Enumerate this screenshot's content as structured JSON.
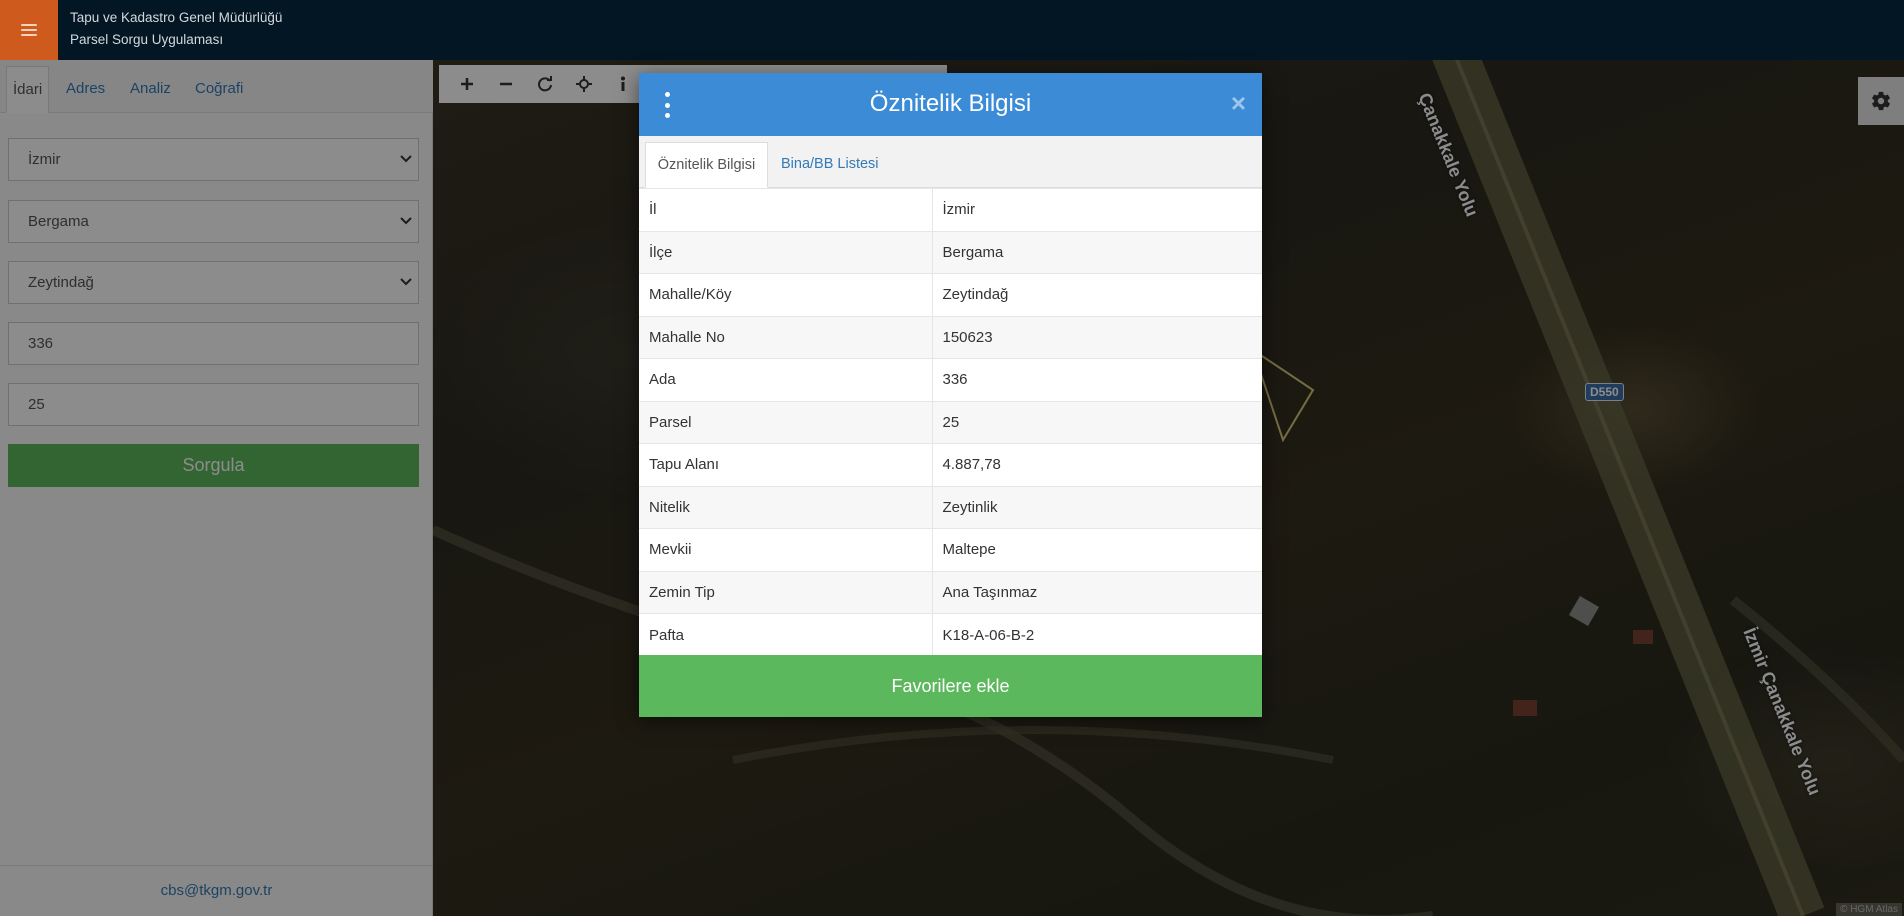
{
  "header": {
    "title_line1": "Tapu ve Kadastro Genel Müdürlüğü",
    "title_line2": "Parsel Sorgu Uygulaması"
  },
  "sidebar": {
    "tabs": [
      {
        "label": "İdari",
        "active": true
      },
      {
        "label": "Adres",
        "active": false
      },
      {
        "label": "Analiz",
        "active": false
      },
      {
        "label": "Coğrafi",
        "active": false
      }
    ],
    "il_select": "İzmir",
    "ilce_select": "Bergama",
    "mahalle_select": "Zeytindağ",
    "ada_input": "336",
    "parsel_input": "25",
    "query_button": "Sorgula",
    "footer_email": "cbs@tkgm.gov.tr"
  },
  "map": {
    "road_label_1": "Çanakkale Yolu",
    "road_label_2": "İzmir Çanakkale Yolu",
    "shield": "D550",
    "attribution": "© HGM Atlas"
  },
  "modal": {
    "title": "Öznitelik Bilgisi",
    "tabs": [
      {
        "label": "Öznitelik Bilgisi",
        "active": true
      },
      {
        "label": "Bina/BB Listesi",
        "active": false
      }
    ],
    "rows": [
      {
        "key": "İl",
        "value": "İzmir"
      },
      {
        "key": "İlçe",
        "value": "Bergama"
      },
      {
        "key": "Mahalle/Köy",
        "value": "Zeytindağ"
      },
      {
        "key": "Mahalle No",
        "value": "150623"
      },
      {
        "key": "Ada",
        "value": "336"
      },
      {
        "key": "Parsel",
        "value": "25"
      },
      {
        "key": "Tapu Alanı",
        "value": "4.887,78"
      },
      {
        "key": "Nitelik",
        "value": "Zeytinlik"
      },
      {
        "key": "Mevkii",
        "value": "Maltepe"
      },
      {
        "key": "Zemin Tip",
        "value": "Ana Taşınmaz"
      },
      {
        "key": "Pafta",
        "value": "K18-A-06-B-2"
      }
    ],
    "favorite_button": "Favorilere ekle"
  },
  "colors": {
    "header_bg": "#031624",
    "menu_accent": "#cf5a1e",
    "modal_header": "#3b8bd6",
    "success_green": "#5cb85c",
    "link_blue": "#337ab7"
  }
}
